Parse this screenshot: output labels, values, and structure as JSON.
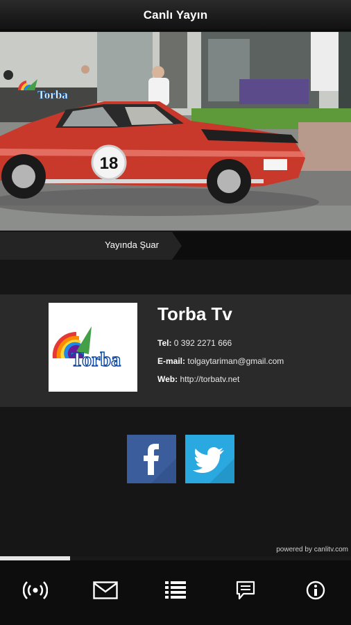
{
  "header": {
    "title": "Canlı Yayın"
  },
  "player": {
    "watermark_logo": "Torba",
    "car_number": "18",
    "now_playing": "Yayında Şuar",
    "progress_fraction": 0.2
  },
  "channel": {
    "logo_text": "Torba",
    "name": "Torba Tv",
    "tel_label": "Tel:",
    "tel_value": "0 392 2271 666",
    "email_label": "E-mail:",
    "email_value": "tolgaytariman@gmail.com",
    "web_label": "Web:",
    "web_value": "http://torbatv.net"
  },
  "social": {
    "facebook_icon": "facebook-icon",
    "twitter_icon": "twitter-icon",
    "colors": {
      "facebook": "#3b5d9c",
      "twitter": "#2aa9e0"
    }
  },
  "footer": {
    "powered": "powered by canlitv.com"
  },
  "bottom_nav": {
    "items": [
      "live-broadcast-icon",
      "mail-icon",
      "list-icon",
      "comment-icon",
      "info-icon"
    ]
  }
}
